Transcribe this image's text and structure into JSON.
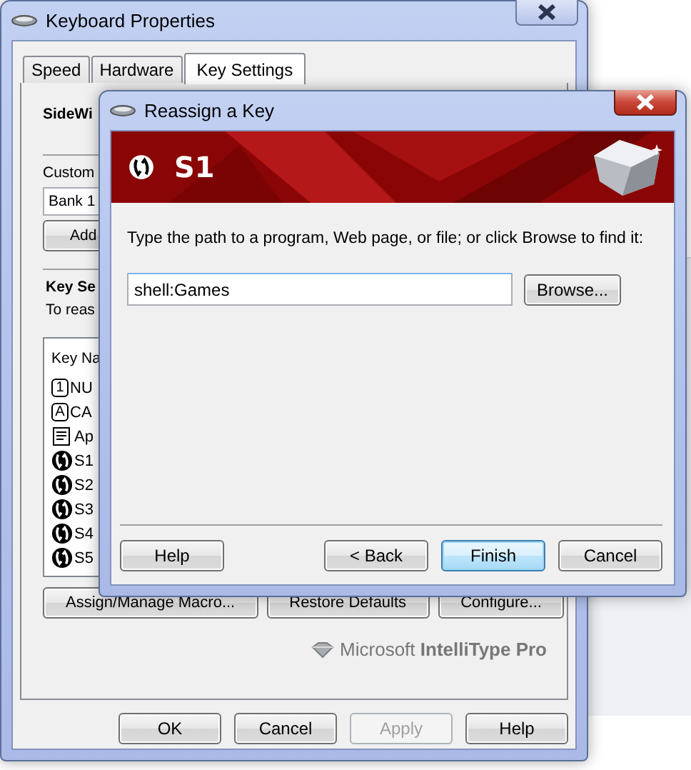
{
  "main_window": {
    "title": "Keyboard Properties",
    "tabs": [
      {
        "label": "Speed",
        "selected": false
      },
      {
        "label": "Hardware",
        "selected": false
      },
      {
        "label": "Key Settings",
        "selected": true
      }
    ],
    "panel": {
      "heading": "SideWi",
      "custom_label": "Custom",
      "bank_field": {
        "value": "Bank 1"
      },
      "add_button": "Add",
      "key_heading": "Key Se",
      "key_hint": "To reas",
      "key_list": {
        "column": "Key Na",
        "rows": [
          {
            "kind": "number-key",
            "glyph": "1",
            "label": "NU"
          },
          {
            "kind": "letter-key",
            "glyph": "A",
            "label": "CA"
          },
          {
            "kind": "app",
            "label": "Ap"
          },
          {
            "kind": "special-key",
            "label": "S1"
          },
          {
            "kind": "special-key",
            "label": "S2"
          },
          {
            "kind": "special-key",
            "label": "S3"
          },
          {
            "kind": "special-key",
            "label": "S4"
          },
          {
            "kind": "special-key",
            "label": "S5"
          }
        ]
      },
      "buttons": [
        "Assign/Manage Macro...",
        "Restore Defaults",
        "Configure..."
      ],
      "logo": "Microsoft **IntelliType Pro**"
    },
    "buttons": [
      {
        "label": "OK",
        "disabled": false
      },
      {
        "label": "Cancel",
        "disabled": false
      },
      {
        "label": "Apply",
        "disabled": true
      },
      {
        "label": "Help",
        "disabled": false
      }
    ]
  },
  "dialog": {
    "title": "Reassign a Key",
    "banner_title": "S1",
    "instruction": "Type the path to a program, Web page, or file; or click Browse to find it:",
    "path_field": {
      "value": "shell:Games"
    },
    "browse_button": "Browse...",
    "buttons": [
      {
        "label": "Help",
        "default": false
      },
      {
        "label": "< Back",
        "default": false
      },
      {
        "label": "Finish",
        "default": true
      },
      {
        "label": "Cancel",
        "default": false
      }
    ]
  }
}
